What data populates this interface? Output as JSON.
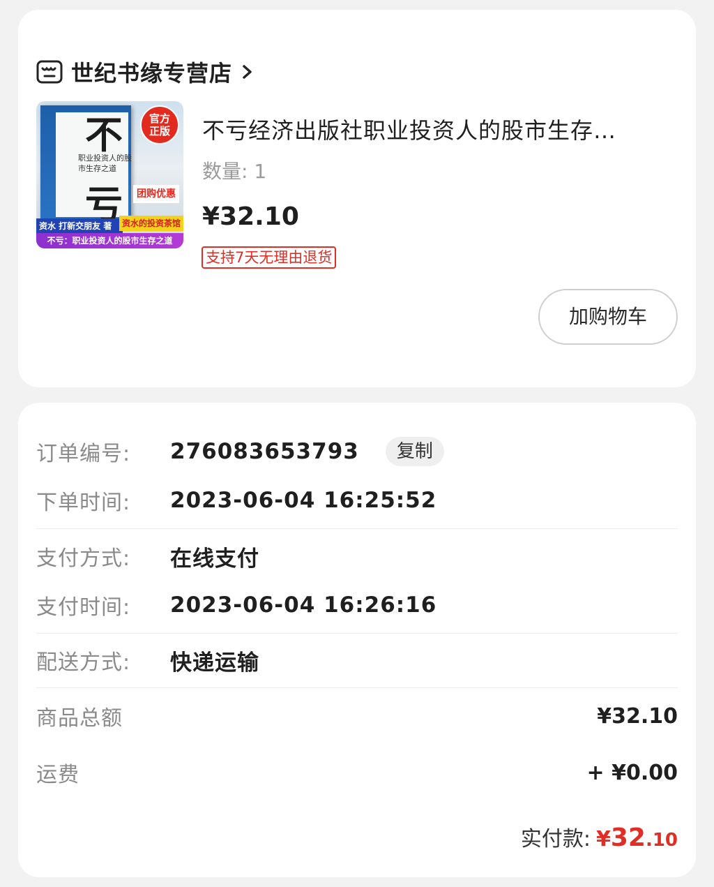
{
  "store": {
    "name": "世纪书缘专营店",
    "icon": "store-icon",
    "chevron_icon": "chevron-right-icon"
  },
  "product": {
    "title": "不亏经济出版社职业投资人的股市生存…",
    "quantity_label": "数量:",
    "quantity_value": "1",
    "price": "¥32.10",
    "return_policy": "支持7天无理由退货",
    "add_to_cart_label": "加购物车",
    "cover": {
      "char_top": "不",
      "char_bottom": "亏",
      "subtitle": "职业投资人的股市生存之道",
      "seal_line1": "官方",
      "seal_line2": "正版",
      "promo": "团购优惠",
      "author": "资水 打新交朋友 著",
      "shop_tag": "资水的投资茶馆",
      "banner": "不亏：职业投资人的股市生存之道"
    }
  },
  "order": {
    "order_no_label": "订单编号:",
    "order_no_value": "276083653793",
    "copy_label": "复制",
    "order_time_label": "下单时间:",
    "order_time_value": "2023-06-04 16:25:52",
    "pay_method_label": "支付方式:",
    "pay_method_value": "在线支付",
    "pay_time_label": "支付时间:",
    "pay_time_value": "2023-06-04 16:26:16",
    "delivery_label": "配送方式:",
    "delivery_value": "快递运输",
    "goods_total_label": "商品总额",
    "goods_total_value": "¥32.10",
    "shipping_label": "运费",
    "shipping_value": "+ ¥0.00",
    "paid_label": "实付款:",
    "paid_currency": "¥",
    "paid_integer": "32",
    "paid_decimal": ".10"
  },
  "colors": {
    "accent_red": "#e02e24",
    "background": "#f2f2f2",
    "card": "#ffffff"
  }
}
